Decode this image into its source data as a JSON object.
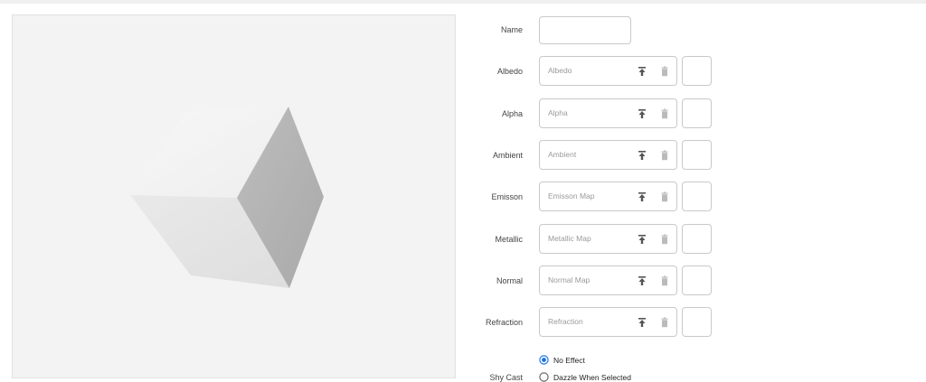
{
  "form": {
    "name_label": "Name",
    "name_value": "",
    "maps": [
      {
        "label": "Albedo",
        "placeholder": "Albedo"
      },
      {
        "label": "Alpha",
        "placeholder": "Alpha"
      },
      {
        "label": "Ambient",
        "placeholder": "Ambient"
      },
      {
        "label": "Emisson",
        "placeholder": "Emisson Map"
      },
      {
        "label": "Metallic",
        "placeholder": "Metallic Map"
      },
      {
        "label": "Normal",
        "placeholder": "Normal Map"
      },
      {
        "label": "Refraction",
        "placeholder": "Refraction"
      }
    ],
    "effect": {
      "label": "Shy Cast",
      "options": [
        "No Effect",
        "Dazzle When Selected"
      ],
      "selected": "No Effect"
    }
  },
  "colors": {
    "accent": "#1a73e8",
    "field_border": "#c9c9c9",
    "viewport_bg": "#f3f3f3"
  },
  "icons": {
    "upload": "upload-icon",
    "delete": "trash-icon"
  }
}
